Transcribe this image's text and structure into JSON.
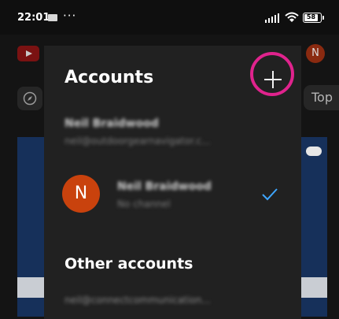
{
  "status_bar": {
    "time": "22:01",
    "more_dots": "···",
    "battery": "58",
    "icons": [
      "app-notification-icon",
      "signal-icon",
      "wifi-icon",
      "battery-icon"
    ]
  },
  "background_app": {
    "icons": [
      "youtube-logo-icon",
      "explore-compass-icon"
    ],
    "avatar_initial": "N",
    "chip_label": "Top"
  },
  "accounts_dialog": {
    "title": "Accounts",
    "add_button_icon": "plus-icon",
    "highlight_color": "#e0238d",
    "accounts": [
      {
        "name": "Neil Braidwood",
        "email": "neil@outdoorgearnavigator.c..."
      },
      {
        "avatar_initial": "N",
        "avatar_color": "#c9420d",
        "name": "Neil Braidwood",
        "subtitle": "No channel",
        "selected": true
      }
    ],
    "other_section_title": "Other accounts",
    "other_accounts": [
      {
        "email": "neil@connectcommunication..."
      }
    ]
  },
  "colors": {
    "accent_check": "#3ea6ff",
    "dialog_bg": "#212121"
  }
}
